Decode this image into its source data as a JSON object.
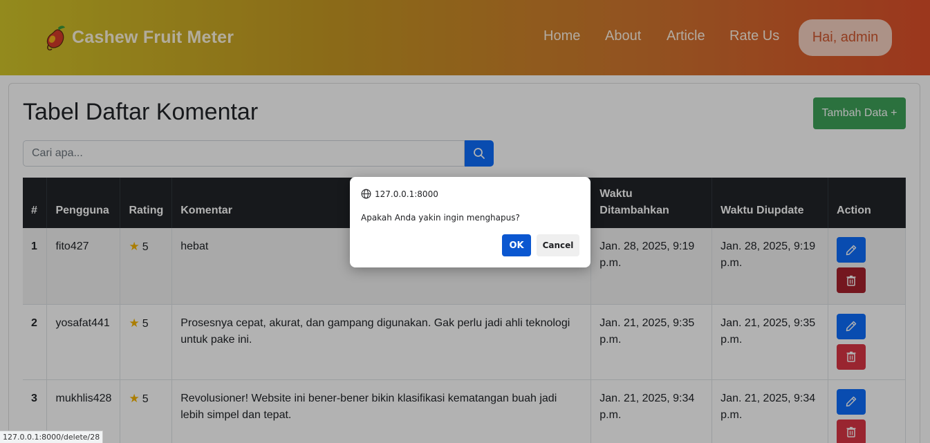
{
  "navbar": {
    "brand": "Cashew Fruit Meter",
    "links": [
      "Home",
      "About",
      "Article",
      "Rate Us"
    ],
    "user": "Hai, admin"
  },
  "main": {
    "title": "Tabel Daftar Komentar",
    "add_button": "Tambah Data +",
    "search_placeholder": "Cari apa..."
  },
  "table": {
    "headers": [
      "#",
      "Pengguna",
      "Rating",
      "Komentar",
      "Waktu Ditambahkan",
      "Waktu Diupdate",
      "Action"
    ],
    "rows": [
      {
        "no": "1",
        "user": "fito427",
        "rating": "5",
        "comment": "hebat",
        "added": "Jan. 28, 2025, 9:19 p.m.",
        "updated": "Jan. 28, 2025, 9:19 p.m."
      },
      {
        "no": "2",
        "user": "yosafat441",
        "rating": "5",
        "comment": "Prosesnya cepat, akurat, dan gampang digunakan. Gak perlu jadi ahli teknologi untuk pake ini.",
        "added": "Jan. 21, 2025, 9:35 p.m.",
        "updated": "Jan. 21, 2025, 9:35 p.m."
      },
      {
        "no": "3",
        "user": "mukhlis428",
        "rating": "5",
        "comment": "Revolusioner! Website ini bener-bener bikin klasifikasi kematangan buah jadi lebih simpel dan tepat.",
        "added": "Jan. 21, 2025, 9:34 p.m.",
        "updated": "Jan. 21, 2025, 9:34 p.m."
      }
    ]
  },
  "dialog": {
    "origin": "127.0.0.1:8000",
    "message": "Apakah Anda yakin ingin menghapus?",
    "ok": "OK",
    "cancel": "Cancel"
  },
  "status_bar": "127.0.0.1:8000/delete/28",
  "colors": {
    "primary": "#0d6efd",
    "danger": "#dc3545",
    "success": "#3ea35a",
    "table_header": "#212529"
  }
}
